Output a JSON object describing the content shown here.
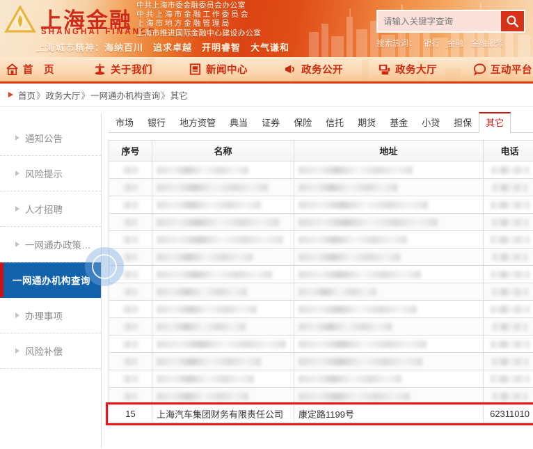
{
  "banner": {
    "logo_cn": "上海金融",
    "logo_en": "SHANGHAI FINANCE",
    "logo_icon": "shanghai-finance-emblem-icon",
    "org_lines": [
      "中共上海市委金融委员会办公室",
      "中共上海市金融工作委员会",
      "上海市地方金融管理局",
      "上海市推进国际金融中心建设办公室"
    ],
    "spirit": "上海城市精神：海纳百川　追求卓越　开明睿智　大气谦和"
  },
  "search": {
    "placeholder": "请输入关键字查询",
    "value": "",
    "button_icon": "search-icon",
    "hot_label": "搜索热词：",
    "hot_words": [
      "银行",
      "金融",
      "金融服务"
    ]
  },
  "nav": {
    "items": [
      {
        "label": "首　页",
        "icon": "home-icon"
      },
      {
        "label": "关于我们",
        "icon": "pagoda-icon"
      },
      {
        "label": "新闻中心",
        "icon": "newspaper-icon"
      },
      {
        "label": "政务公开",
        "icon": "megaphone-icon"
      },
      {
        "label": "政务大厅",
        "icon": "service-hall-icon"
      },
      {
        "label": "互动平台",
        "icon": "chat-bubble-icon"
      }
    ]
  },
  "breadcrumb": {
    "arrow_icon": "triangle-right-icon",
    "items": [
      "首页",
      "政务大厅",
      "一网通办机构查询",
      "其它"
    ],
    "separator": "》"
  },
  "sidebar": {
    "items": [
      {
        "label": "通知公告",
        "active": false
      },
      {
        "label": "风险提示",
        "active": false
      },
      {
        "label": "人才招聘",
        "active": false
      },
      {
        "label": "一网通办政策…",
        "active": false
      },
      {
        "label": "一网通办机构查询",
        "active": true
      },
      {
        "label": "办理事项",
        "active": false
      },
      {
        "label": "风险补偿",
        "active": false
      }
    ]
  },
  "tabs": [
    {
      "label": "市场",
      "active": false
    },
    {
      "label": "银行",
      "active": false
    },
    {
      "label": "地方资管",
      "active": false
    },
    {
      "label": "典当",
      "active": false
    },
    {
      "label": "证券",
      "active": false
    },
    {
      "label": "保险",
      "active": false
    },
    {
      "label": "信托",
      "active": false
    },
    {
      "label": "期货",
      "active": false
    },
    {
      "label": "基金",
      "active": false
    },
    {
      "label": "小贷",
      "active": false
    },
    {
      "label": "担保",
      "active": false
    },
    {
      "label": "其它",
      "active": true
    }
  ],
  "table": {
    "headers": [
      "序号",
      "名称",
      "地址",
      "电话"
    ],
    "redacted_rows": [
      {
        "idx_w": 22,
        "name_w": 132,
        "addr_w": 164,
        "tel_w": 54
      },
      {
        "idx_w": 20,
        "name_w": 160,
        "addr_w": 142,
        "tel_w": 50
      },
      {
        "idx_w": 22,
        "name_w": 150,
        "addr_w": 186,
        "tel_w": 56
      },
      {
        "idx_w": 20,
        "name_w": 176,
        "addr_w": 200,
        "tel_w": 52
      },
      {
        "idx_w": 22,
        "name_w": 182,
        "addr_w": 156,
        "tel_w": 56
      },
      {
        "idx_w": 20,
        "name_w": 138,
        "addr_w": 146,
        "tel_w": 50
      },
      {
        "idx_w": 22,
        "name_w": 166,
        "addr_w": 176,
        "tel_w": 56
      },
      {
        "idx_w": 20,
        "name_w": 130,
        "addr_w": 112,
        "tel_w": 52
      },
      {
        "idx_w": 22,
        "name_w": 144,
        "addr_w": 170,
        "tel_w": 56
      },
      {
        "idx_w": 20,
        "name_w": 128,
        "addr_w": 134,
        "tel_w": 50
      },
      {
        "idx_w": 22,
        "name_w": 186,
        "addr_w": 184,
        "tel_w": 56
      },
      {
        "idx_w": 20,
        "name_w": 150,
        "addr_w": 178,
        "tel_w": 52
      },
      {
        "idx_w": 22,
        "name_w": 140,
        "addr_w": 148,
        "tel_w": 56
      },
      {
        "idx_w": 20,
        "name_w": 132,
        "addr_w": 160,
        "tel_w": 50
      }
    ],
    "highlighted_row": {
      "idx": "15",
      "name": "上海汽车集团财务有限责任公司",
      "address": "康定路1199号",
      "phone": "62311010"
    }
  },
  "colors": {
    "brand_red": "#cc1414",
    "banner_orange": "#dc4413",
    "active_blue": "#1263ac",
    "highlight_red": "#f01616"
  }
}
